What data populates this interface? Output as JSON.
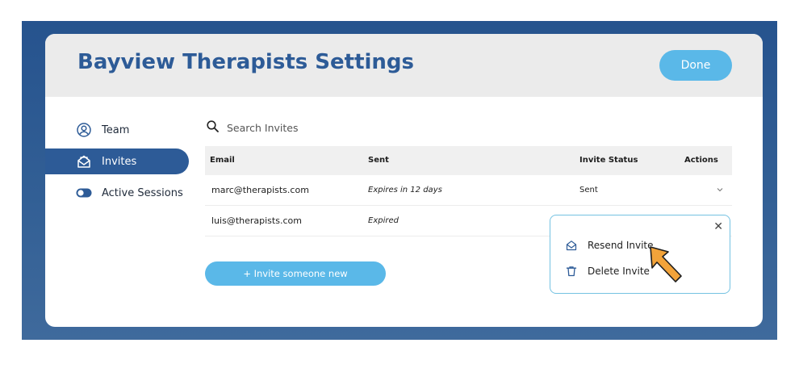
{
  "window": {
    "title": "Bayview Therapists Settings",
    "done_label": "Done"
  },
  "sidebar": {
    "items": [
      {
        "label": "Team",
        "icon": "user-circle-icon"
      },
      {
        "label": "Invites",
        "icon": "envelope-open-icon"
      },
      {
        "label": "Active Sessions",
        "icon": "toggle-icon"
      }
    ],
    "active_index": 1
  },
  "search": {
    "placeholder": "Search Invites",
    "value": ""
  },
  "table": {
    "headers": [
      "Email",
      "Sent",
      "Invite Status",
      "Actions"
    ],
    "rows": [
      {
        "email": "marc@therapists.com",
        "sent": "Expires in 12 days",
        "status": "Sent"
      },
      {
        "email": "luis@therapists.com",
        "sent": "Expired",
        "status": ""
      }
    ]
  },
  "invite_button_label": "+ Invite someone new",
  "popup": {
    "items": [
      "Resend Invite",
      "Delete Invite"
    ]
  },
  "colors": {
    "brand": "#2d5b97",
    "accent": "#5ab8e8",
    "popup_border": "#74c2e2",
    "cursor": "#f2a33a"
  }
}
